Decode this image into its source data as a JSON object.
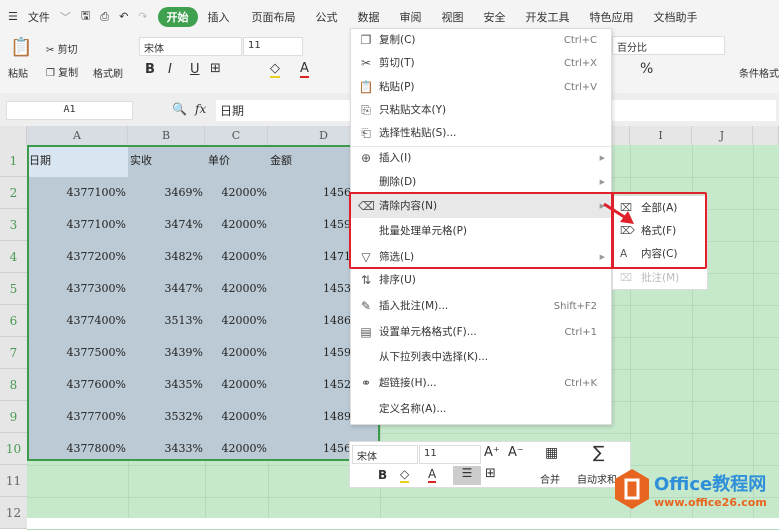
{
  "menubar": {
    "file": "文件",
    "tabs": [
      "开始",
      "插入",
      "页面布局",
      "公式",
      "数据",
      "审阅",
      "视图",
      "安全",
      "开发工具",
      "特色应用",
      "文档助手"
    ]
  },
  "ribbon": {
    "paste": "粘贴",
    "cut": "剪切",
    "copy": "复制",
    "format_painter": "格式刷",
    "font": "宋体",
    "size": "11",
    "number_format": "百分比",
    "cond_format": "条件格式",
    "bold": "B",
    "italic": "I",
    "underline": "U"
  },
  "formula_bar": {
    "cell_ref": "A1",
    "fx": "fx",
    "value": "日期"
  },
  "columns": [
    "A",
    "B",
    "C",
    "D",
    "I",
    "J"
  ],
  "rows": [
    "1",
    "2",
    "3",
    "4",
    "5",
    "6",
    "7",
    "8",
    "9",
    "10",
    "11",
    "12"
  ],
  "headers": [
    "日期",
    "实收",
    "单价",
    "金额"
  ],
  "data": [
    [
      "4377100%",
      "3469%",
      "42000%",
      "1456"
    ],
    [
      "4377100%",
      "3474%",
      "42000%",
      "1459"
    ],
    [
      "4377200%",
      "3482%",
      "42000%",
      "1471"
    ],
    [
      "4377300%",
      "3447%",
      "42000%",
      "1453"
    ],
    [
      "4377400%",
      "3513%",
      "42000%",
      "1486"
    ],
    [
      "4377500%",
      "3439%",
      "42000%",
      "1459"
    ],
    [
      "4377600%",
      "3435%",
      "42000%",
      "1452"
    ],
    [
      "4377700%",
      "3532%",
      "42000%",
      "1489"
    ],
    [
      "4377800%",
      "3433%",
      "42000%",
      "1456"
    ]
  ],
  "context_menu": [
    {
      "label": "复制(C)",
      "shortcut": "Ctrl+C",
      "icon": "copy-icon"
    },
    {
      "label": "剪切(T)",
      "shortcut": "Ctrl+X",
      "icon": "cut-icon"
    },
    {
      "label": "粘贴(P)",
      "shortcut": "Ctrl+V",
      "icon": "paste-icon"
    },
    {
      "label": "只粘贴文本(Y)",
      "shortcut": "",
      "icon": "paste-text-icon"
    },
    {
      "label": "选择性粘贴(S)...",
      "shortcut": "",
      "icon": "paste-special-icon"
    },
    {
      "label": "插入(I)",
      "shortcut": "",
      "icon": "insert-icon"
    },
    {
      "label": "删除(D)",
      "shortcut": "",
      "icon": ""
    },
    {
      "label": "清除内容(N)",
      "shortcut": "",
      "icon": "clear-icon"
    },
    {
      "label": "批量处理单元格(P)",
      "shortcut": "",
      "icon": ""
    },
    {
      "label": "筛选(L)",
      "shortcut": "",
      "icon": "filter-icon"
    },
    {
      "label": "排序(U)",
      "shortcut": "",
      "icon": "sort-icon"
    },
    {
      "label": "插入批注(M)...",
      "shortcut": "Shift+F2",
      "icon": "comment-icon"
    },
    {
      "label": "设置单元格格式(F)...",
      "shortcut": "Ctrl+1",
      "icon": "format-cells-icon"
    },
    {
      "label": "从下拉列表中选择(K)...",
      "shortcut": "",
      "icon": ""
    },
    {
      "label": "超链接(H)...",
      "shortcut": "Ctrl+K",
      "icon": "link-icon"
    },
    {
      "label": "定义名称(A)...",
      "shortcut": "",
      "icon": ""
    }
  ],
  "submenu": [
    "全部(A)",
    "格式(F)",
    "内容(C)",
    "批注(M)"
  ],
  "mini_toolbar": {
    "font": "宋体",
    "size": "11",
    "merge": "合并",
    "autosum": "自动求和"
  },
  "watermark": {
    "title": "Office教程网",
    "url": "www.office26.com"
  },
  "colors": {
    "accent": "#3fa04f",
    "highlight": "#e0202a"
  }
}
